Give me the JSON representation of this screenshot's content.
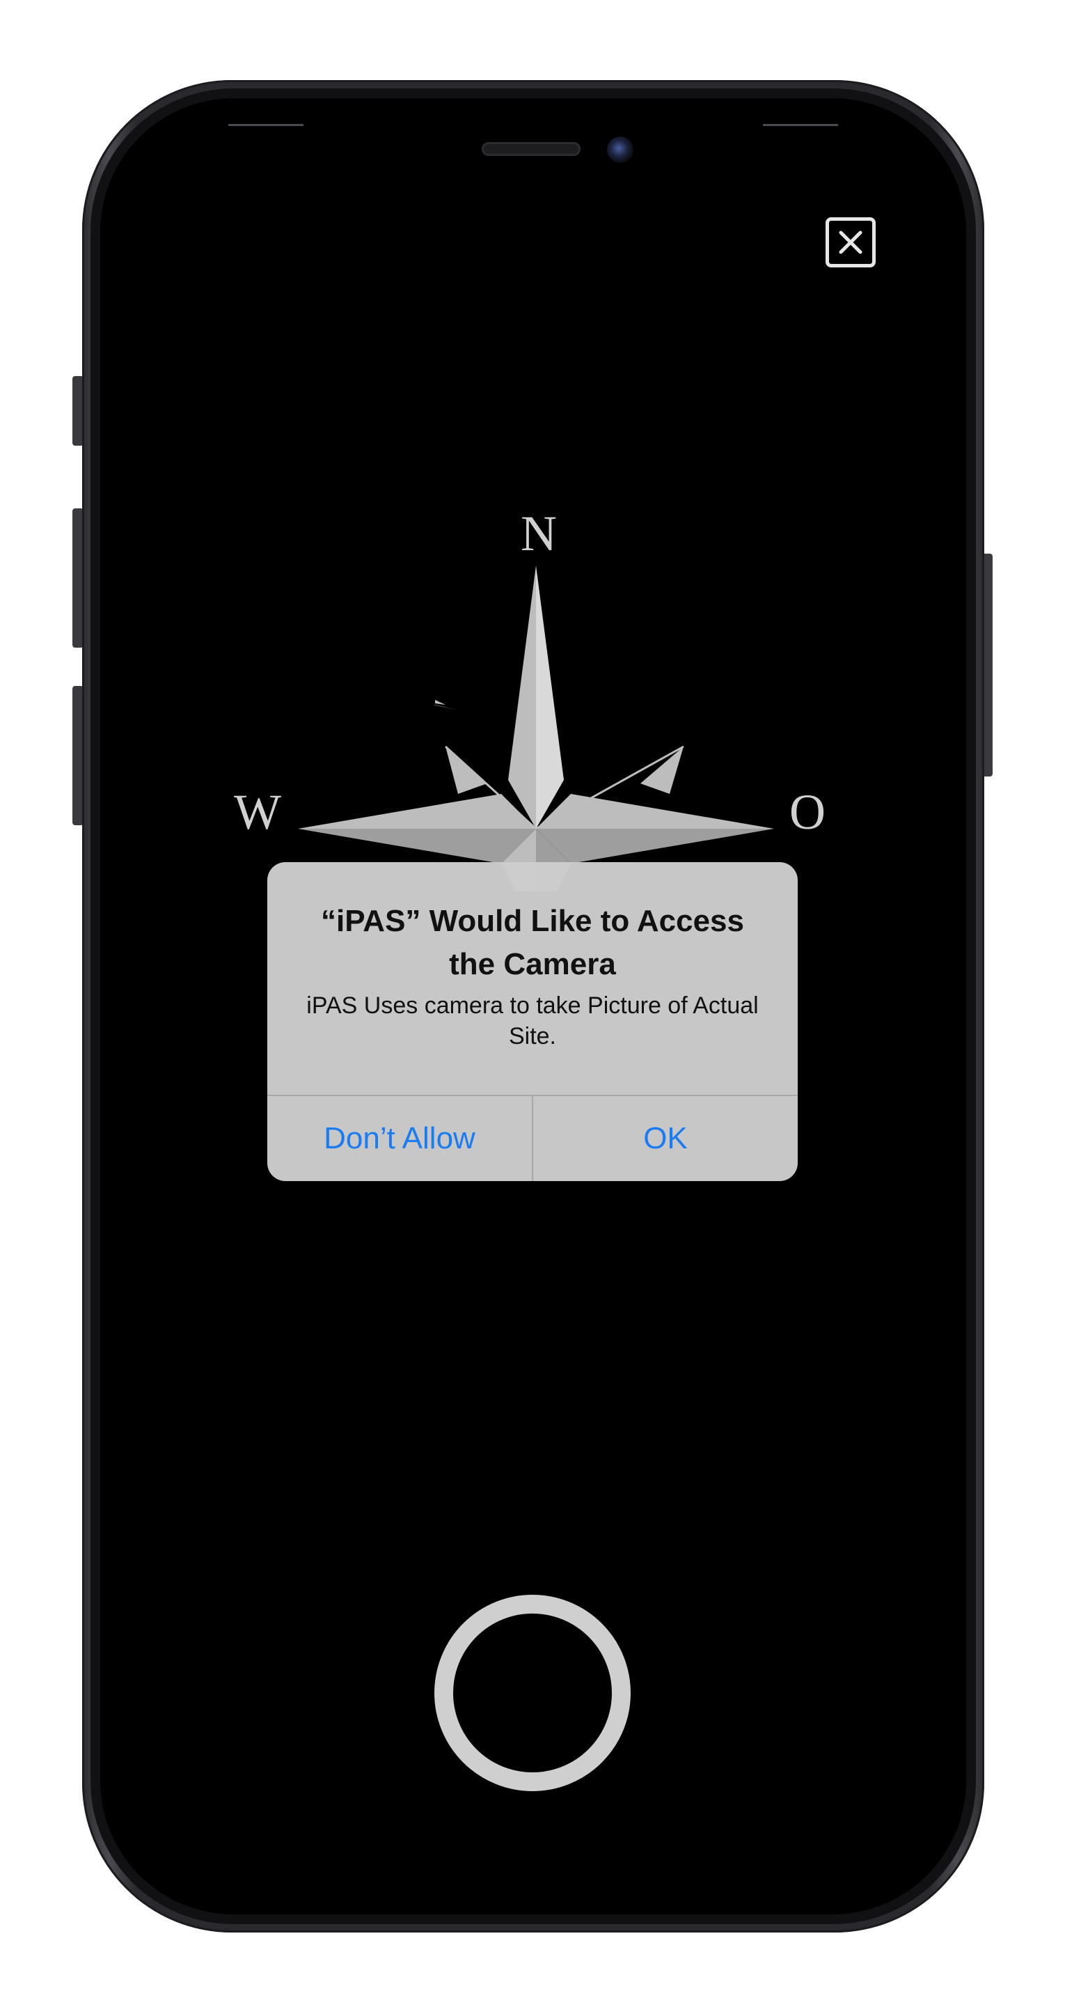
{
  "screen": {
    "close_icon": "close-icon",
    "compass": {
      "north_label": "N",
      "west_label": "W",
      "east_label": "O"
    },
    "shutter_icon": "shutter-ring"
  },
  "alert": {
    "title": "“iPAS” Would Like to Access the Camera",
    "message": "iPAS Uses camera to take Picture of Actual Site.",
    "dont_allow_label": "Don’t Allow",
    "ok_label": "OK"
  },
  "colors": {
    "screen_background": "#000000",
    "alert_background": "#cdcdcd",
    "action_blue": "#1a7cf0",
    "compass_fill": "#bdbdbd"
  }
}
